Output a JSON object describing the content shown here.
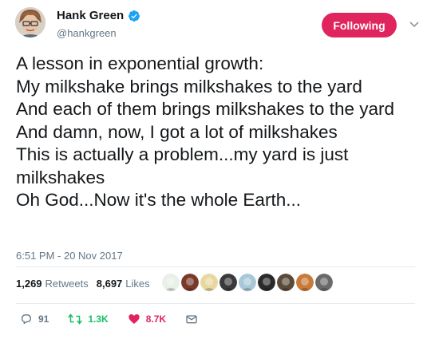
{
  "author": {
    "display_name": "Hank Green",
    "handle": "@hankgreen",
    "verified_icon": "verified-badge-icon",
    "avatar_icon": "avatar"
  },
  "follow_button": {
    "label": "Following",
    "color": "#e0245e"
  },
  "menu_icon": "chevron-down-icon",
  "tweet": {
    "lines": [
      "A lesson in exponential growth:",
      "My milkshake brings milkshakes to the yard",
      "And each of them brings milkshakes to the yard",
      "And damn, now, I got a lot of milkshakes",
      "This is actually a problem...my yard is just milkshakes",
      "Oh God...Now it's the whole Earth..."
    ],
    "timestamp": "6:51 PM - 20 Nov 2017"
  },
  "stats": {
    "retweets_count": "1,269",
    "retweets_label": "Retweets",
    "likes_count": "8,697",
    "likes_label": "Likes"
  },
  "likers": [
    {
      "icon": "liker-avatar-icon",
      "color": "#e8f0e8"
    },
    {
      "icon": "liker-avatar-icon",
      "color": "#7a3a2a"
    },
    {
      "icon": "liker-avatar-icon",
      "color": "#e8d8a0"
    },
    {
      "icon": "liker-avatar-icon",
      "color": "#3a3a3a"
    },
    {
      "icon": "liker-avatar-icon",
      "color": "#a8c8d8"
    },
    {
      "icon": "liker-avatar-icon",
      "color": "#2a2a2a"
    },
    {
      "icon": "liker-avatar-icon",
      "color": "#5a4a3a"
    },
    {
      "icon": "liker-avatar-icon",
      "color": "#c87a3a"
    },
    {
      "icon": "liker-avatar-icon",
      "color": "#6a6a6a"
    }
  ],
  "actions": {
    "reply_count": "91",
    "retweet_count": "1.3K",
    "like_count": "8.7K",
    "reply_icon": "reply-icon",
    "retweet_icon": "retweet-icon",
    "like_icon": "heart-icon",
    "message_icon": "direct-message-icon"
  },
  "colors": {
    "text": "#14171a",
    "secondary": "#657786",
    "verified": "#1da1f2",
    "retweet": "#17bf63",
    "like": "#e0245e"
  }
}
